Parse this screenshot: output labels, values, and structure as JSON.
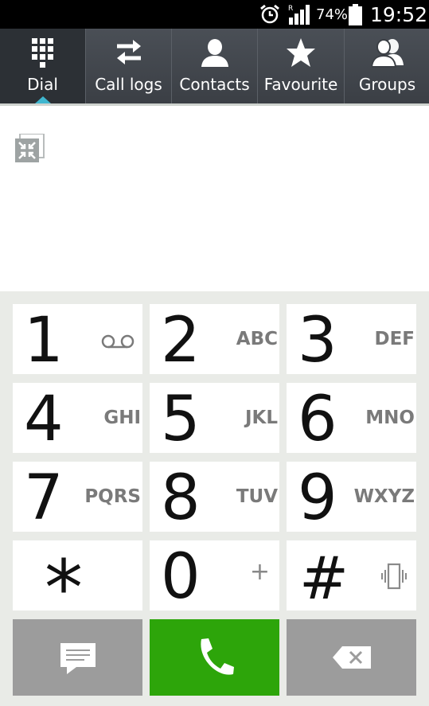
{
  "status_bar": {
    "battery_percent": "74%",
    "time": "19:52",
    "signal_indicator": "R",
    "icons": [
      "alarm-icon",
      "signal-icon",
      "battery-icon"
    ]
  },
  "tabs": [
    {
      "label": "Dial",
      "icon": "dialpad-icon",
      "active": true
    },
    {
      "label": "Call logs",
      "icon": "swap-arrows-icon",
      "active": false
    },
    {
      "label": "Contacts",
      "icon": "person-icon",
      "active": false
    },
    {
      "label": "Favourite",
      "icon": "star-icon",
      "active": false
    },
    {
      "label": "Groups",
      "icon": "group-icon",
      "active": false
    }
  ],
  "keys": [
    {
      "digit": "1",
      "letters": "",
      "icon": "voicemail-icon"
    },
    {
      "digit": "2",
      "letters": "ABC"
    },
    {
      "digit": "3",
      "letters": "DEF"
    },
    {
      "digit": "4",
      "letters": "GHI"
    },
    {
      "digit": "5",
      "letters": "JKL"
    },
    {
      "digit": "6",
      "letters": "MNO"
    },
    {
      "digit": "7",
      "letters": "PQRS"
    },
    {
      "digit": "8",
      "letters": "TUV"
    },
    {
      "digit": "9",
      "letters": "WXYZ"
    },
    {
      "digit": "*",
      "letters": ""
    },
    {
      "digit": "0",
      "letters": "+"
    },
    {
      "digit": "#",
      "letters": "",
      "icon": "vibrate-icon"
    }
  ],
  "actions": [
    "message-icon",
    "phone-icon",
    "backspace-icon"
  ],
  "colors": {
    "call_green": "#2da50a",
    "action_gray": "#9c9c9c",
    "tab_indicator": "#3fb6cf",
    "tab_bar": "#3b3f45"
  }
}
